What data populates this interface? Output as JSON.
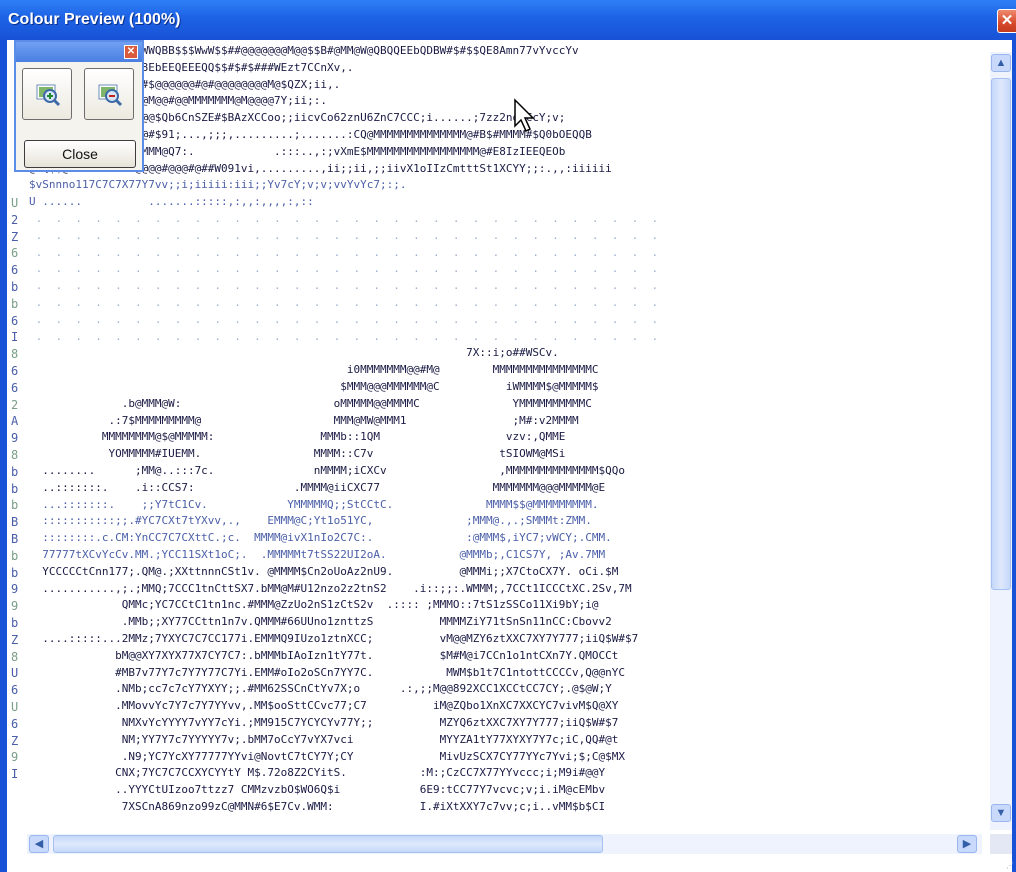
{
  "window": {
    "title": "Colour Preview (100%)",
    "close_glyph": "✕"
  },
  "toolbox": {
    "close_glyph": "✕",
    "zoom_in_icon": "zoom-in-icon",
    "zoom_out_icon": "zoom-out-icon",
    "close_label": "Close"
  },
  "scrollbars": {
    "up_arrow": "▲",
    "down_arrow": "▼",
    "left_arrow": "◀",
    "right_arrow": "▶"
  },
  "ascii": {
    "lines": [
      "@@@@@@@#@##$$$$QBWWQBB$$$WwW$$##@@@@@@@M@@$$B#@MM@W@QBQQEEbQDBW#$#$$QE8Amn77vYvccYv",
      "BQQbbZ86966A9AZ688EbEEQEEEQQ$$#$#$###WEzt7CCnXv,.",
      "QWQQbb9bbQQQWWW$$#$@@@@@@#@#@@@@@@@@M@$QZX;ii,.",
      "BWBQWQ$B#$##@#@@@@M@@#@@MMMMMMM@M@@@@7Y;ii;:.",
      "B$$#$@#@#@@@@#@@@@@$Qb6CnSZE#$BAzXCCoo;;iicvCo62znU6ZnC7CCC;i......;7zz2no1CcY;v;",
      "#@#@#@@@@#@#@@@@#@#$91;...,;;;,.........;.......:CQ@MMMMMMMMMMMMMM@#B$#MMMM#$Q0bOEQQB",
      "MMMMMMMMM@M@MMMM@MMM@Q7:.            .:::..,:;vXmE$MMMMMMMMMMMMMMMMM@#E8IzIEEQEOb",
      "@EQ$$@MMMMMVMVMM@@@@#@@@#@##W091vi,.........,ii;;ii,;;iivX1oIIzCmtttSt1XCYY;;:.,,:iiiiii",
      "$vSnnno117C7C7X77Y7vv;;i;iiiii:iii;;Yv7cY;v;v;vvYvYc7;:;.",
      "U ......          .......:::::,:,,:,,,,:,::",
      "",
      "",
      "",
      "",
      "",
      "",
      "",
      "",
      "                                                                  7X::i;o##WSCv.",
      "                                                i0MMMMMMM@@#M@        MMMMMMMMMMMMMMMC",
      "                                               $MMM@@@MMMMMM@C          iWMMMM$@MMMMM$",
      "              .b@MMM@W:                       oMMMMM@@MMMMC              YMMMMMMMMMMC",
      "            .:7$MMMMMMMMM@                    MMM@MW@MMM1                ;M#:v2MMMM",
      "           MMMMMMMM@$@MMMMM:                MMMb::1QM                   vzv:,QMME",
      "            YOMMMMM#IUEMM.                 MMMM::C7v                   tSIOWM@MSi",
      "  ........      ;MM@..:::7c.               nMMMM;iCXCv                 ,MMMMMMMMMMMMMM$QQo",
      "  ..:::::::.    .i::CCS7:               .MMMM@iiCXC77                 MMMMMMM@@@MMMMM@E",
      "  ...:::::::.    ;;Y7tC1Cv.            YMMMMMQ;;StCCtC.              MMMM$$@MMMMMMMMM.",
      "  :::::::::::;;.#YC7CXt7tYXvv,.,    EMMM@C;Yt1o51YC,              ;MMM@.,.;SMMMt:ZMM.",
      "  ::::::::.c.CM:YnCC7C7CXttC.;c.  MMMM@ivX1nIo2C7C:.              :@MMM$,iYC7;vWCY;.CMM.",
      "  77777tXCvYcCv.MM.;YCC11SXt1oC;.  .MMMMMt7tSS22UI2oA.           @MMMb;,C1CS7Y, ;Av.7MM",
      "  YCCCCCtCnn177;.QM@.;XXttnnnCSt1v. @MMMM$Cn2oUoAz2nU9.          @MMMi;;X7CtoCX7Y. oCi.$M",
      "  ...........,;.;MMQ;7CCC1tnCttSX7.bMM@M#U12nzo2z2tnS2    .i::;;:.WMMM;,7CCt1ICCCtXC.2Sv,7M",
      "              QMMc;YC7CCtC1tn1nc.#MMM@ZzUo2nS1zCtS2v  .:::: ;MMMO::7tS1zSSCo11Xi9bY;i@",
      "              .MMb;;XY77CCttn1n7v.QMMM#66UUno1znttzS          MMMMZiY71tSnSn11nCC:Cbovv2",
      "  ....:::::...2MMz;7YXYC7C7CC177i.EMMMQ9IUzo1ztnXCC;          vM@@MZY6ztXXC7XY7Y777;iiQ$W#$7",
      "             bM@@XY7XYX77X7CY7C7:.bMMMbIAoIzn1tY77t.          $M#M@i7CCn1o1ntCXn7Y.QMOCCt",
      "             #MB7v77Y7c7Y7Y77C7Yi.EMM#oIo2oSCn7YY7C.           MWM$b1t7C1ntottCCCCv,Q@@nYC",
      "             .NMb;cc7c7cY7YXYY;;.#MM62SSCnCtYv7X;o      .:,;;M@@892XCC1XCCtCC7CY;.@$@W;Y",
      "             .MMovvYc7Y7c7Y7YYvv,.MM$ooSttCCvc77;C7          iM@ZQbo1XnXC7XXCYC7vivM$Q@XY",
      "              NMXvYcYYYY7vYY7cYi.;MM915C7YCYCYv77Y;;          MZYQ6ztXXC7XY7Y777;iiQ$W#$7",
      "              NM;YY7Y7c7YYYYY7v;.bMM7oCcY7vYX7vci             MYYZA1tY77XYXY7Y7c;iC,QQ#@t",
      "              .N9;YC7YcXY77777YYvi@NovtC7tCY7Y;CY             MivUzSCX7CY77YYc7Yvi;$;C@$MX",
      "             CNX;7YC7C7CCXYCYYtY M$.72o8Z2CYitS.           :M:;CzCC7X77YYvccc;i;M9i#@@Y",
      "             ..YYYCtUIzoo7ttzz7 CMMzvzbO$WO6Q$i            6E9:tCC77Y7vcvc;v;i.iM@cEMbv",
      "              7XSCnA869nzo99zC@MMN#6$E7Cv.WMM:             I.#iXtXXY7c7vv;c;i..vMM$b$CI"
    ],
    "side_chars": [
      "U",
      "2",
      "Z",
      "6",
      "6",
      "b",
      "b",
      "6",
      "I",
      "8",
      "6",
      "6",
      "2",
      "A",
      "9",
      "8",
      "b",
      "b",
      "b",
      "B",
      "B",
      "b",
      "b",
      "9",
      "9",
      "b",
      "Z",
      "8",
      "U",
      "6",
      "U",
      "6",
      "Z",
      "9",
      "I"
    ]
  },
  "colors": {
    "titlebar": "#1d62e5",
    "window_border": "#1852d6",
    "ascii_dark": "#1a1a44",
    "ascii_blue": "#4a5ea8",
    "ascii_green": "#7a9e86",
    "ascii_light": "#9db0cc"
  }
}
